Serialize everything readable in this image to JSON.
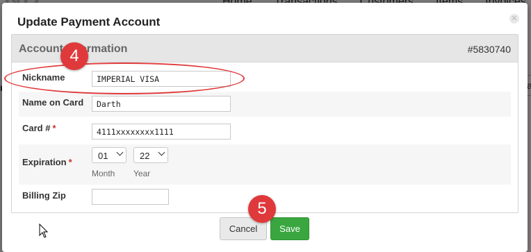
{
  "background": {
    "logo": "ND",
    "nav": [
      "Home",
      "Transactions",
      "Customers",
      "Items",
      "Invoices"
    ],
    "right_field_text": "la",
    "left_letter": "n"
  },
  "modal": {
    "title": "Update Payment Account",
    "close_icon": "close-icon"
  },
  "panel": {
    "header_title": "Account Information",
    "account_id": "#5830740"
  },
  "form": {
    "nickname_label": "Nickname",
    "nickname_value": "IMPERIAL VISA",
    "name_on_card_label": "Name on Card",
    "name_on_card_value": "Darth",
    "card_number_label": "Card #",
    "card_number_value": "4111xxxxxxxx1111",
    "required_marker": "*",
    "expiration_label": "Expiration",
    "month_value": "01",
    "year_value": "22",
    "month_caption": "Month",
    "year_caption": "Year",
    "billing_zip_label": "Billing Zip",
    "billing_zip_value": ""
  },
  "buttons": {
    "cancel_label": "Cancel",
    "save_label": "Save"
  },
  "annotations": {
    "step_nickname": "4",
    "step_save": "5",
    "accent_color": "#e0393b"
  },
  "colors": {
    "save_green": "#3aa640",
    "required_red": "#c9302c"
  }
}
